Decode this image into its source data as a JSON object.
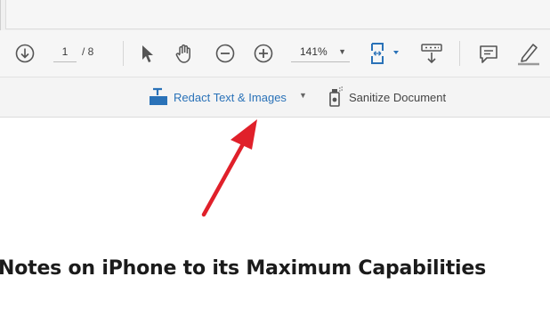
{
  "toolbar": {
    "page_current": "1",
    "page_total": "/ 8",
    "zoom": "141%",
    "icons": [
      "scroll-down-icon",
      "select-arrow-icon",
      "hand-tool-icon",
      "zoom-out-icon",
      "zoom-in-icon",
      "fit-page-icon",
      "scroll-mode-icon",
      "comment-icon",
      "highlight-pen-icon"
    ]
  },
  "redact_toolbar": {
    "redact_label": "Redact Text & Images",
    "sanitize_label": "Sanitize Document"
  },
  "document": {
    "heading": "Notes on iPhone to its Maximum Capabilities"
  },
  "colors": {
    "accent_blue": "#2a72b8",
    "annotation_red": "#e0202a"
  }
}
